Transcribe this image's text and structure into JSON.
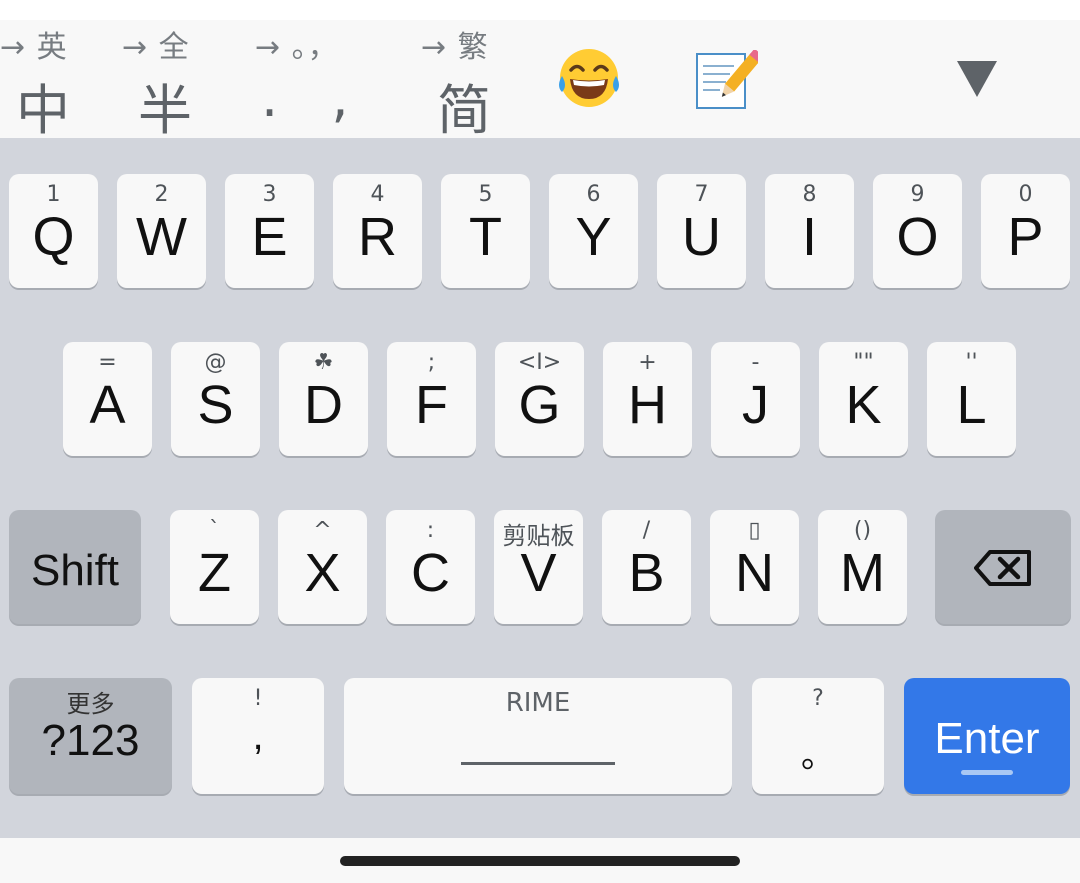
{
  "toolbar": {
    "chinese": {
      "hint": "→ 英",
      "label": "中"
    },
    "half": {
      "hint": "→ 全",
      "label": "半"
    },
    "punct": {
      "hint": "→ 。，",
      "label": ". ,"
    },
    "simplified": {
      "hint": "→ 繁",
      "label": "简"
    },
    "emoji_icon": "laughing-emoji-icon",
    "memo_icon": "memo-pencil-icon",
    "collapse_icon": "triangle-down-icon"
  },
  "rows": {
    "row1": [
      {
        "hint": "1",
        "label": "Q"
      },
      {
        "hint": "2",
        "label": "W"
      },
      {
        "hint": "3",
        "label": "E"
      },
      {
        "hint": "4",
        "label": "R"
      },
      {
        "hint": "5",
        "label": "T"
      },
      {
        "hint": "6",
        "label": "Y"
      },
      {
        "hint": "7",
        "label": "U"
      },
      {
        "hint": "8",
        "label": "I"
      },
      {
        "hint": "9",
        "label": "O"
      },
      {
        "hint": "0",
        "label": "P"
      }
    ],
    "row2": [
      {
        "hint": "=",
        "label": "A"
      },
      {
        "hint": "@",
        "label": "S"
      },
      {
        "hint": "☘",
        "label": "D"
      },
      {
        "hint": ";",
        "label": "F"
      },
      {
        "hint": "<I>",
        "label": "G"
      },
      {
        "hint": "+",
        "label": "H"
      },
      {
        "hint": "-",
        "label": "J"
      },
      {
        "hint": "\"\"",
        "label": "K"
      },
      {
        "hint": "''",
        "label": "L"
      }
    ],
    "row3": [
      {
        "hint": "`",
        "label": "Z"
      },
      {
        "hint": "^",
        "label": "X"
      },
      {
        "hint": ":",
        "label": "C"
      },
      {
        "hint": "剪贴板",
        "label": "V"
      },
      {
        "hint": "/",
        "label": "B"
      },
      {
        "hint": "▯",
        "label": "N"
      },
      {
        "hint": "()",
        "label": "M"
      }
    ]
  },
  "shift_label": "Shift",
  "backspace_icon": "backspace-icon",
  "bottom": {
    "more": {
      "hint": "更多",
      "label": "?123"
    },
    "comma": {
      "hint": "!",
      "label": ","
    },
    "space": {
      "hint": "RIME"
    },
    "period": {
      "hint": "?",
      "label": "。"
    },
    "enter_label": "Enter"
  },
  "colors": {
    "enter": "#3378e8",
    "keyboard_bg": "#d2d5dc",
    "key": "#f8f8f8",
    "key_dark": "#b1b5bc"
  }
}
